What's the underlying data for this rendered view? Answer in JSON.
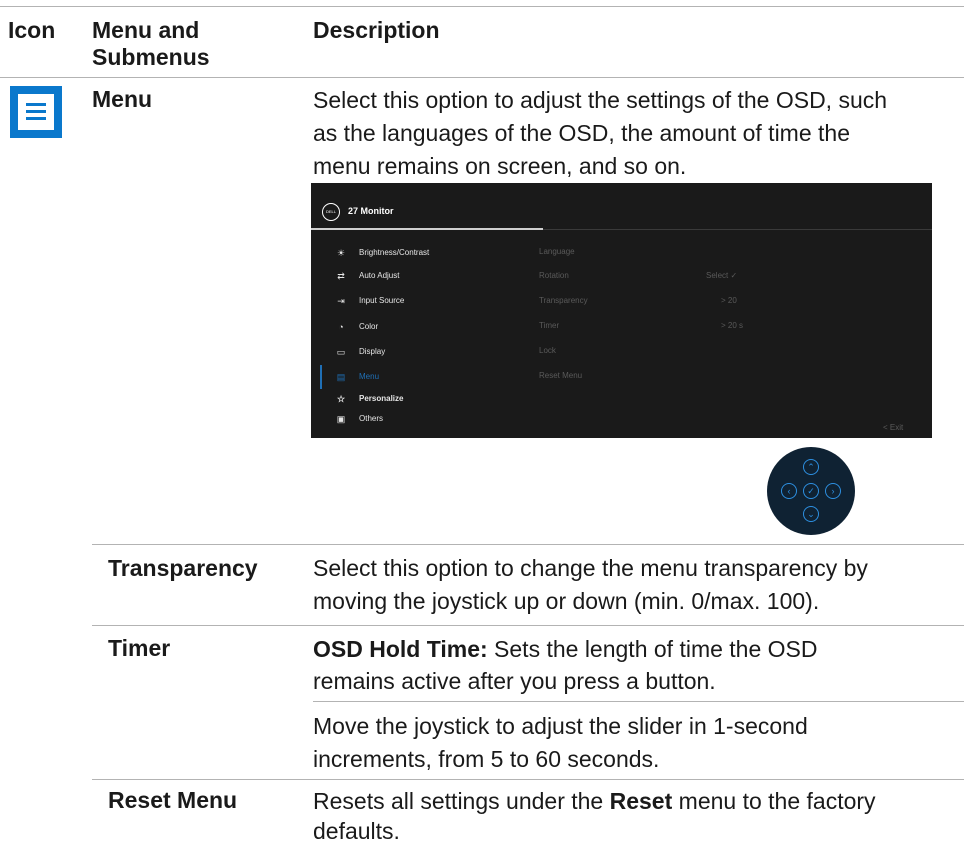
{
  "header": {
    "icon": "Icon",
    "menu_line1": "Menu and",
    "menu_line2": "Submenus",
    "description": "Description"
  },
  "menu_row": {
    "icon": "menu-list-icon",
    "name": "Menu",
    "desc_lines": [
      "Select this option to adjust the settings of the OSD, such",
      "as the languages of the OSD, the amount of time the",
      "menu remains on screen, and so on."
    ]
  },
  "osd": {
    "logo": "DELL",
    "title": "27 Monitor",
    "items": [
      {
        "icon": "sun-icon",
        "glyph": "☀",
        "label": "Brightness/Contrast"
      },
      {
        "icon": "auto-adjust-icon",
        "glyph": "⇄",
        "label": "Auto Adjust"
      },
      {
        "icon": "input-source-icon",
        "glyph": "⇥",
        "label": "Input Source"
      },
      {
        "icon": "color-palette-icon",
        "glyph": "◔",
        "label": "Color"
      },
      {
        "icon": "display-icon",
        "glyph": "▭",
        "label": "Display"
      },
      {
        "icon": "menu-icon",
        "glyph": "▤",
        "label": "Menu"
      },
      {
        "icon": "star-icon",
        "glyph": "☆",
        "label": "Personalize"
      },
      {
        "icon": "others-icon",
        "glyph": "▣",
        "label": "Others"
      }
    ],
    "middle": [
      "Language",
      "Rotation",
      "Transparency",
      "Timer",
      "Lock",
      "Reset Menu"
    ],
    "select_label": "Select ✓",
    "transparency_value": "> 20",
    "timer_value": "> 20 s",
    "exit_label": "< Exit",
    "selected_color": "#1f6fb5"
  },
  "joystick": {
    "up": "⌃",
    "left": "‹",
    "center": "✓",
    "right": "›",
    "down": "⌄"
  },
  "rows": {
    "transparency": {
      "name": "Transparency",
      "desc_lines": [
        "Select this option to change the menu transparency by",
        "moving the joystick up or down (min. 0/max. 100)."
      ]
    },
    "timer": {
      "name": "Timer",
      "hold_label": "OSD Hold Time:",
      "hold_text": " Sets the length of time the OSD",
      "hold_line2": "remains active after you press a button.",
      "move_lines": [
        "Move the joystick to adjust the slider in 1-second",
        "increments, from 5 to 60 seconds."
      ]
    },
    "reset": {
      "name": "Reset Menu",
      "pre": "Resets all settings under the ",
      "bold": "Reset",
      "post": " menu to the factory",
      "line2": "defaults."
    }
  },
  "accent_color": "#0a78cc"
}
